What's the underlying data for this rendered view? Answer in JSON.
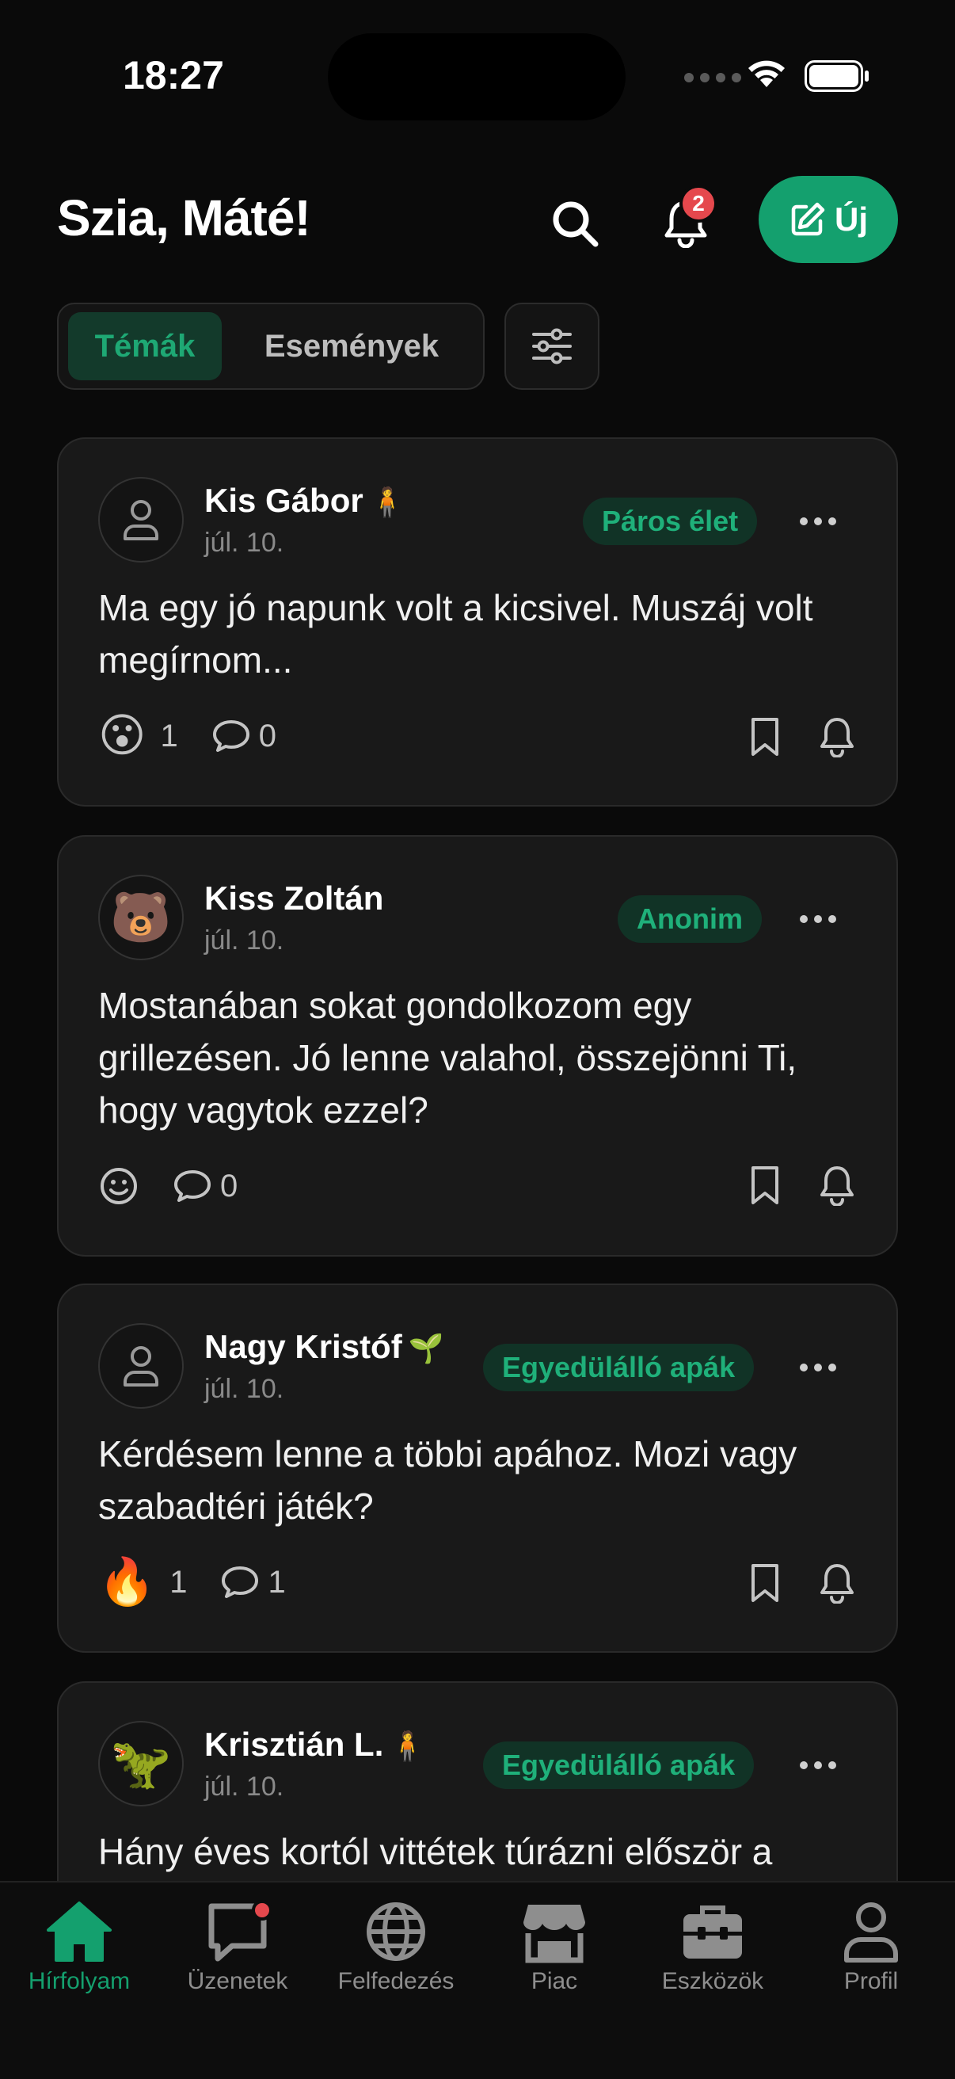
{
  "status_bar": {
    "time": "18:27"
  },
  "header": {
    "greeting": "Szia, Máté!",
    "notification_count": "2",
    "new_button_label": "Új"
  },
  "segments": {
    "active": "Témák",
    "inactive": "Események"
  },
  "posts": [
    {
      "author": "Kis Gábor",
      "author_badge": "🧍",
      "date": "júl. 10.",
      "tag": "Páros élet",
      "text": "Ma egy jó napunk volt a kicsivel. Muszáj volt megírnom...",
      "reaction_emoji": "😮",
      "reaction_count": "1",
      "comment_count": "0"
    },
    {
      "author": "Kiss Zoltán",
      "author_badge": "",
      "avatar_emoji": "🐻",
      "date": "júl. 10.",
      "tag": "Anonim",
      "text": "Mostanában sokat gondolkozom egy grillezésen. Jó lenne valahol, összejönni Ti, hogy vagytok ezzel?",
      "reaction_emoji": "",
      "reaction_count": "",
      "comment_count": "0"
    },
    {
      "author": "Nagy Kristóf",
      "author_badge": "🌱",
      "date": "júl. 10.",
      "tag": "Egyedülálló apák",
      "text": "Kérdésem lenne a többi apához. Mozi vagy szabadtéri játék?",
      "reaction_emoji": "🔥",
      "reaction_count": "1",
      "comment_count": "1"
    },
    {
      "author": "Krisztián L.",
      "author_badge": "🧍",
      "avatar_emoji": "🦖",
      "date": "júl. 10.",
      "tag": "Egyedülálló apák",
      "text": "Hány éves kortól vittétek túrázni először a"
    }
  ],
  "tabbar": {
    "items": [
      {
        "label": "Hírfolyam",
        "icon": "home-icon"
      },
      {
        "label": "Üzenetek",
        "icon": "chat-icon"
      },
      {
        "label": "Felfedezés",
        "icon": "globe-icon"
      },
      {
        "label": "Piac",
        "icon": "store-icon"
      },
      {
        "label": "Eszközök",
        "icon": "toolbox-icon"
      },
      {
        "label": "Profil",
        "icon": "person-icon"
      }
    ]
  },
  "colors": {
    "accent": "#14a06e",
    "badge": "#e5484d",
    "card": "#191919",
    "background": "#0a0a0a"
  }
}
